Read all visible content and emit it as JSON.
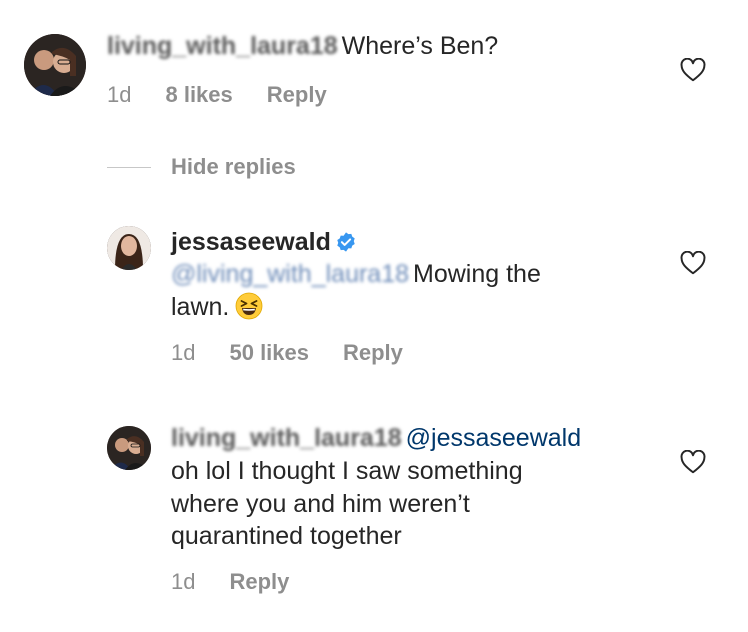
{
  "comments": [
    {
      "username_blurred": "living_with_laura18",
      "text": "Where’s Ben?",
      "time": "1d",
      "likes": "8 likes",
      "reply": "Reply"
    },
    {
      "username": "jessaseewald",
      "mention_blurred": "@living_with_laura18",
      "text_line1": "Mowing the",
      "text_line2": "lawn.",
      "time": "1d",
      "likes": "50 likes",
      "reply": "Reply",
      "emoji": "grinning-squinting-face"
    },
    {
      "username_blurred": "living_with_laura18",
      "mention": "@jessaseewald",
      "text_line1": "oh lol I thought I saw something",
      "text_line2": "where you and him weren’t",
      "text_line3": "quarantined together",
      "time": "1d",
      "reply": "Reply"
    }
  ],
  "hide_replies": "Hide replies",
  "icons": {
    "like": "heart-outline-icon",
    "verified": "verified-badge-icon"
  },
  "colors": {
    "text": "#262626",
    "secondary": "#8e8e8e",
    "mention": "#00376b",
    "verified": "#3897f0"
  }
}
